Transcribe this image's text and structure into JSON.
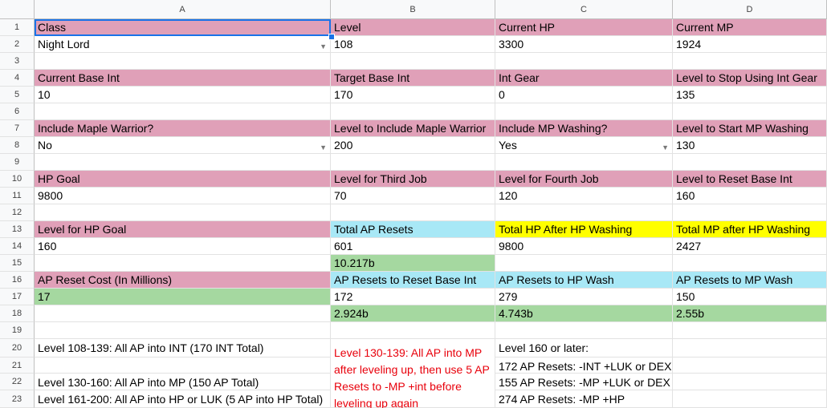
{
  "columns": [
    "A",
    "B",
    "C",
    "D"
  ],
  "rows": [
    "1",
    "2",
    "3",
    "4",
    "5",
    "6",
    "7",
    "8",
    "9",
    "10",
    "11",
    "12",
    "13",
    "14",
    "15",
    "16",
    "17",
    "18",
    "19",
    "20",
    "21",
    "22",
    "23"
  ],
  "cells": {
    "A1": "Class",
    "B1": "Level",
    "C1": "Current HP",
    "D1": "Current MP",
    "A2": "Night Lord",
    "B2": "108",
    "C2": "3300",
    "D2": "1924",
    "A4": "Current Base Int",
    "B4": "Target Base Int",
    "C4": "Int Gear",
    "D4": "Level to Stop Using Int Gear",
    "A5": "10",
    "B5": "170",
    "C5": "0",
    "D5": "135",
    "A7": "Include Maple Warrior?",
    "B7": "Level to Include Maple Warrior",
    "C7": "Include MP Washing?",
    "D7": "Level to Start MP Washing",
    "A8": "No",
    "B8": "200",
    "C8": "Yes",
    "D8": "130",
    "A10": "HP Goal",
    "B10": "Level for Third Job",
    "C10": "Level for Fourth Job",
    "D10": "Level to Reset Base Int",
    "A11": "9800",
    "B11": "70",
    "C11": "120",
    "D11": "160",
    "A13": "Level for HP Goal",
    "B13": "Total AP Resets",
    "C13": "Total HP After HP Washing",
    "D13": "Total MP after HP Washing",
    "A14": "160",
    "B14": "601",
    "C14": "9800",
    "D14": "2427",
    "B15": "10.217b",
    "A16": "AP Reset Cost (In Millions)",
    "B16": "AP Resets to Reset Base Int",
    "C16": "AP Resets to HP Wash",
    "D16": "AP Resets to MP Wash",
    "A17": "17",
    "B17": "172",
    "C17": "279",
    "D17": "150",
    "B18": "2.924b",
    "C18": "4.743b",
    "D18": "2.55b",
    "A20": "Level 108-139: All AP into INT (170 INT Total)",
    "A22": "Level 130-160: All AP into MP (150 AP Total)",
    "A23": "Level 161-200: All AP into HP or LUK (5 AP into HP Total)",
    "B20": "Level 130-139: All AP into MP after leveling up, then use 5 AP Resets to -MP +int before leveling up again",
    "C20": "Level 160 or later:",
    "C21": "172 AP Resets: -INT +LUK or DEX",
    "C22": "155 AP Resets: -MP +LUK or DEX",
    "C23": "274 AP Resets: -MP +HP"
  },
  "colors": {
    "pink": "#e0a0b8",
    "cyan": "#a8e8f6",
    "yellow": "#ffff00",
    "green": "#a5d8a0",
    "red": "#e8000b",
    "selection": "#1a73e8"
  }
}
